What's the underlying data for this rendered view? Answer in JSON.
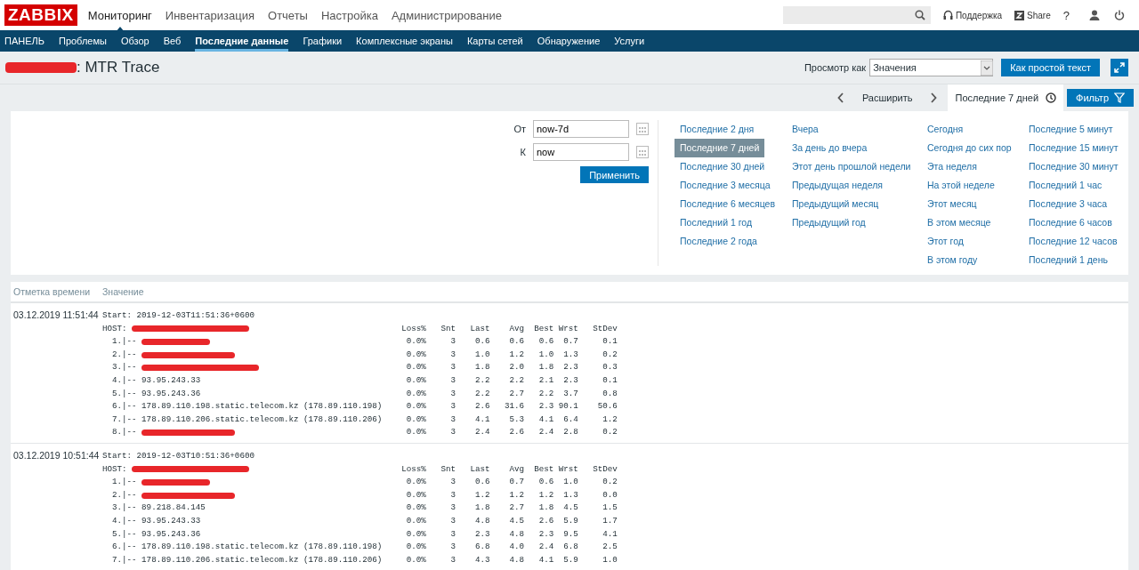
{
  "logo": "ZABBIX",
  "main_menu": [
    {
      "label": "Мониторинг",
      "selected": true
    },
    {
      "label": "Инвентаризация",
      "selected": false
    },
    {
      "label": "Отчеты",
      "selected": false
    },
    {
      "label": "Настройка",
      "selected": false
    },
    {
      "label": "Администрирование",
      "selected": false
    }
  ],
  "top_links": {
    "support": "Поддержка",
    "share": "Share",
    "help": "?"
  },
  "sub_menu": [
    {
      "label": "ПАНЕЛЬ",
      "selected": false
    },
    {
      "label": "Проблемы",
      "selected": false
    },
    {
      "label": "Обзор",
      "selected": false
    },
    {
      "label": "Веб",
      "selected": false
    },
    {
      "label": "Последние данные",
      "selected": true
    },
    {
      "label": "Графики",
      "selected": false
    },
    {
      "label": "Комплексные экраны",
      "selected": false
    },
    {
      "label": "Карты сетей",
      "selected": false
    },
    {
      "label": "Обнаружение",
      "selected": false
    },
    {
      "label": "Услуги",
      "selected": false
    }
  ],
  "page": {
    "title": ": MTR Trace",
    "title_redacted": true,
    "view_as_label": "Просмотр как",
    "view_as_value": "Значения",
    "plain_text_button": "Как простой текст"
  },
  "time_nav": {
    "zoom_out": "Расширить",
    "range_tab": "Последние 7 дней",
    "filter_tab": "Фильтр"
  },
  "filter": {
    "from_label": "От",
    "from_value": "now-7d",
    "to_label": "К",
    "to_value": "now",
    "apply": "Применить",
    "quick_ranges": [
      [
        {
          "label": "Последние 2 дня",
          "selected": false
        },
        {
          "label": "Последние 7 дней",
          "selected": true
        },
        {
          "label": "Последние 30 дней",
          "selected": false
        },
        {
          "label": "Последние 3 месяца",
          "selected": false
        },
        {
          "label": "Последние 6 месяцев",
          "selected": false
        },
        {
          "label": "Последний 1 год",
          "selected": false
        },
        {
          "label": "Последние 2 года",
          "selected": false
        }
      ],
      [
        {
          "label": "Вчера",
          "selected": false
        },
        {
          "label": "За день до вчера",
          "selected": false
        },
        {
          "label": "Этот день прошлой недели",
          "selected": false
        },
        {
          "label": "Предыдущая неделя",
          "selected": false
        },
        {
          "label": "Предыдущий месяц",
          "selected": false
        },
        {
          "label": "Предыдущий год",
          "selected": false
        }
      ],
      [
        {
          "label": "Сегодня",
          "selected": false
        },
        {
          "label": "Сегодня до сих пор",
          "selected": false
        },
        {
          "label": "Эта неделя",
          "selected": false
        },
        {
          "label": "На этой неделе",
          "selected": false
        },
        {
          "label": "Этот месяц",
          "selected": false
        },
        {
          "label": "В этом месяце",
          "selected": false
        },
        {
          "label": "Этот год",
          "selected": false
        },
        {
          "label": "В этом году",
          "selected": false
        }
      ],
      [
        {
          "label": "Последние 5 минут",
          "selected": false
        },
        {
          "label": "Последние 15 минут",
          "selected": false
        },
        {
          "label": "Последние 30 минут",
          "selected": false
        },
        {
          "label": "Последний 1 час",
          "selected": false
        },
        {
          "label": "Последние 3 часа",
          "selected": false
        },
        {
          "label": "Последние 6 часов",
          "selected": false
        },
        {
          "label": "Последние 12 часов",
          "selected": false
        },
        {
          "label": "Последний 1 день",
          "selected": false
        }
      ]
    ]
  },
  "table": {
    "columns": [
      "Отметка времени",
      "Значение"
    ],
    "rows": [
      {
        "timestamp": "03.12.2019 11:51:44",
        "start": "Start: 2019-12-03T11:51:36+0600",
        "host": "HOST: ",
        "host_redacted": true,
        "header": [
          "Loss%",
          "Snt",
          "Last",
          "Avg",
          "Best",
          "Wrst",
          "StDev"
        ],
        "hops": [
          {
            "hop": "  1.|-- ",
            "redacted": true,
            "stats": [
              "0.0%",
              "3",
              "0.6",
              "0.6",
              "0.6",
              "0.7",
              "0.1"
            ]
          },
          {
            "hop": "  2.|-- ",
            "redacted": true,
            "stats": [
              "0.0%",
              "3",
              "1.0",
              "1.2",
              "1.0",
              "1.3",
              "0.2"
            ]
          },
          {
            "hop": "  3.|-- ",
            "redacted": true,
            "stats": [
              "0.0%",
              "3",
              "1.8",
              "2.0",
              "1.8",
              "2.3",
              "0.3"
            ]
          },
          {
            "hop": "  4.|-- ",
            "host": "93.95.243.33",
            "stats": [
              "0.0%",
              "3",
              "2.2",
              "2.2",
              "2.1",
              "2.3",
              "0.1"
            ]
          },
          {
            "hop": "  5.|-- ",
            "host": "93.95.243.36",
            "stats": [
              "0.0%",
              "3",
              "2.2",
              "2.7",
              "2.2",
              "3.7",
              "0.8"
            ]
          },
          {
            "hop": "  6.|-- ",
            "host": "178.89.110.198.static.telecom.kz (178.89.110.198)",
            "stats": [
              "0.0%",
              "3",
              "2.6",
              "31.6",
              "2.3",
              "90.1",
              "50.6"
            ]
          },
          {
            "hop": "  7.|-- ",
            "host": "178.89.110.206.static.telecom.kz (178.89.110.206)",
            "stats": [
              "0.0%",
              "3",
              "4.1",
              "5.3",
              "4.1",
              "6.4",
              "1.2"
            ]
          },
          {
            "hop": "  8.|-- ",
            "redacted": true,
            "stats": [
              "0.0%",
              "3",
              "2.4",
              "2.6",
              "2.4",
              "2.8",
              "0.2"
            ]
          }
        ]
      },
      {
        "timestamp": "03.12.2019 10:51:44",
        "start": "Start: 2019-12-03T10:51:36+0600",
        "host": "HOST: ",
        "host_redacted": true,
        "header": [
          "Loss%",
          "Snt",
          "Last",
          "Avg",
          "Best",
          "Wrst",
          "StDev"
        ],
        "hops": [
          {
            "hop": "  1.|-- ",
            "redacted": true,
            "stats": [
              "0.0%",
              "3",
              "0.6",
              "0.7",
              "0.6",
              "1.0",
              "0.2"
            ]
          },
          {
            "hop": "  2.|-- ",
            "redacted": true,
            "stats": [
              "0.0%",
              "3",
              "1.2",
              "1.2",
              "1.2",
              "1.3",
              "0.0"
            ]
          },
          {
            "hop": "  3.|-- ",
            "host": "89.218.84.145",
            "stats": [
              "0.0%",
              "3",
              "1.8",
              "2.7",
              "1.8",
              "4.5",
              "1.5"
            ]
          },
          {
            "hop": "  4.|-- ",
            "host": "93.95.243.33",
            "stats": [
              "0.0%",
              "3",
              "4.8",
              "4.5",
              "2.6",
              "5.9",
              "1.7"
            ]
          },
          {
            "hop": "  5.|-- ",
            "host": "93.95.243.36",
            "stats": [
              "0.0%",
              "3",
              "2.3",
              "4.8",
              "2.3",
              "9.5",
              "4.1"
            ]
          },
          {
            "hop": "  6.|-- ",
            "host": "178.89.110.198.static.telecom.kz (178.89.110.198)",
            "stats": [
              "0.0%",
              "3",
              "6.8",
              "4.0",
              "2.4",
              "6.8",
              "2.5"
            ]
          },
          {
            "hop": "  7.|-- ",
            "host": "178.89.110.206.static.telecom.kz (178.89.110.206)",
            "stats": [
              "0.0%",
              "3",
              "4.3",
              "4.8",
              "4.1",
              "5.9",
              "1.0"
            ]
          }
        ]
      }
    ]
  }
}
